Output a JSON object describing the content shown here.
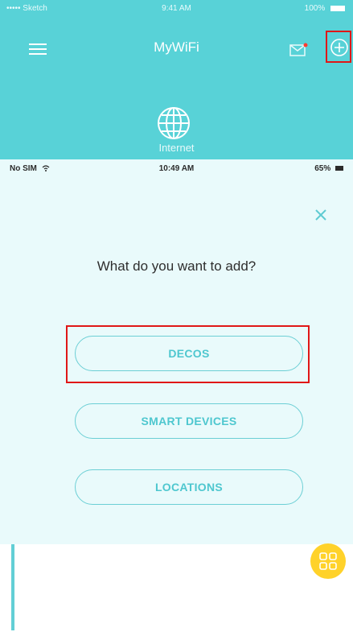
{
  "bg_app": {
    "status_bar": {
      "carrier": "••••• Sketch",
      "time": "9:41 AM",
      "battery": "100%"
    },
    "title": "MyWiFi",
    "internet_label": "Internet"
  },
  "modal": {
    "status_bar": {
      "carrier": "No SIM",
      "time": "10:49 AM",
      "battery": "65%"
    },
    "heading": "What do you want to add?",
    "options": [
      {
        "label": "DECOS"
      },
      {
        "label": "SMART DEVICES"
      },
      {
        "label": "LOCATIONS"
      }
    ]
  },
  "colors": {
    "teal": "#58d2d7",
    "modal_bg": "#e9fafb",
    "accent_text": "#4ec7cf",
    "highlight_red": "#e01717",
    "fab_yellow": "#ffd22a"
  },
  "icons": [
    "menu-icon",
    "mail-icon",
    "plus-circle-icon",
    "globe-icon",
    "close-icon",
    "grid-icon"
  ]
}
